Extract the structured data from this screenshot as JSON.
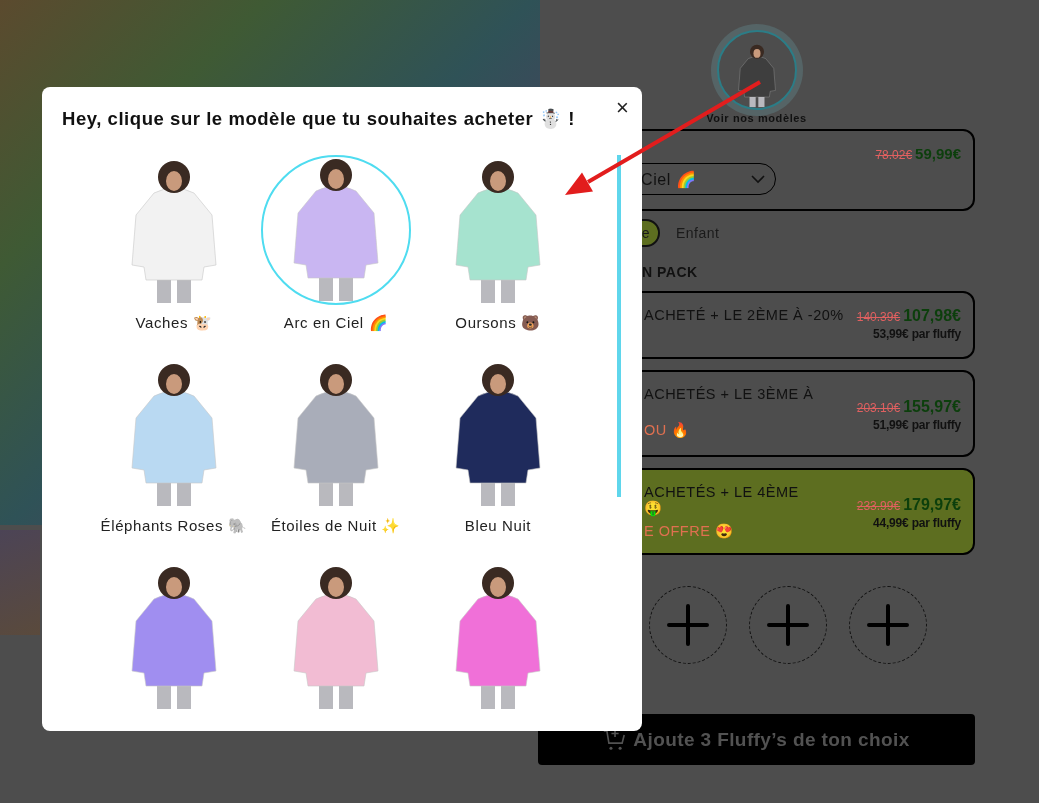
{
  "models_link": {
    "label": "Voir nos modèles"
  },
  "product": {
    "old_price": "78.02€",
    "price": "59,99€",
    "model_select": {
      "value": "Ciel 🌈"
    }
  },
  "sizes": [
    {
      "label": "e",
      "selected": true
    },
    {
      "label": "Enfant",
      "selected": false
    }
  ],
  "pack_heading": "N PACK",
  "packs": [
    {
      "title_lines": [
        "ACHETÉ + LE 2ÈME À -20%"
      ],
      "old_price": "140.39€",
      "price": "107,98€",
      "unit_price": "53,99€ par fluffy",
      "selected": false
    },
    {
      "title_lines": [
        "ACHETÉS + LE 3ÈME À"
      ],
      "note": "OU 🔥",
      "old_price": "203.10€",
      "price": "155,97€",
      "unit_price": "51,99€ par fluffy",
      "selected": false
    },
    {
      "title_lines": [
        "ACHETÉS + LE 4ÈME",
        "🤑"
      ],
      "note": "E OFFRE 😍",
      "old_price": "233.99€",
      "price": "179,97€",
      "unit_price": "44,99€ par fluffy",
      "selected": true
    }
  ],
  "slots": [
    {
      "kind": "empty"
    },
    {
      "kind": "empty"
    },
    {
      "kind": "empty"
    }
  ],
  "add_button": {
    "label": "Ajoute 3 Fluffy’s de ton choix"
  },
  "modal": {
    "title": "Hey, clique sur le modèle que tu souhaites acheter ☃️ !",
    "close": "×",
    "models": [
      {
        "name": "Vaches 🐮",
        "selected": false,
        "color": "#f2f2f2"
      },
      {
        "name": "Arc en Ciel 🌈",
        "selected": true,
        "color": "#c9b6f2"
      },
      {
        "name": "Oursons 🐻",
        "selected": false,
        "color": "#a6e3cf"
      },
      {
        "name": "Éléphants Roses 🐘",
        "selected": false,
        "color": "#b9d9f2"
      },
      {
        "name": "Étoiles de Nuit ✨",
        "selected": false,
        "color": "#a9adb9"
      },
      {
        "name": "Bleu Nuit",
        "selected": false,
        "color": "#1f2b5c"
      },
      {
        "selected": false,
        "color": "#a08ef0"
      },
      {
        "selected": false,
        "color": "#f2bcd3"
      },
      {
        "selected": false,
        "color": "#f070d8"
      }
    ]
  }
}
